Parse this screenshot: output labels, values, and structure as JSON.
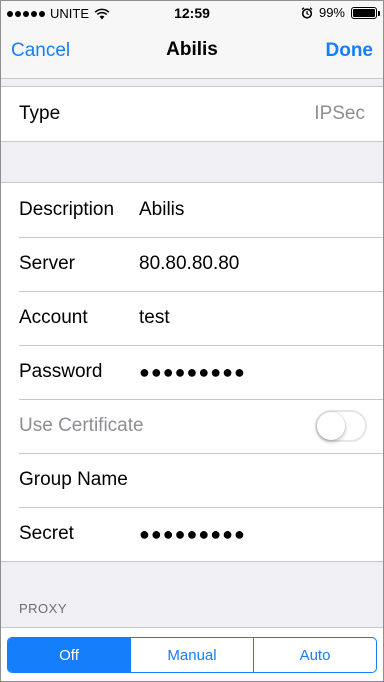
{
  "status_bar": {
    "carrier": "UNITE",
    "time": "12:59",
    "battery": "99%",
    "battery_level": 0.99
  },
  "nav": {
    "cancel_label": "Cancel",
    "title": "Abilis",
    "done_label": "Done"
  },
  "type_row": {
    "label": "Type",
    "value": "IPSec"
  },
  "fields": {
    "description": {
      "label": "Description",
      "value": "Abilis"
    },
    "server": {
      "label": "Server",
      "value": "80.80.80.80"
    },
    "account": {
      "label": "Account",
      "value": "test"
    },
    "password": {
      "label": "Password",
      "value": "●●●●●●●●●"
    },
    "use_certificate": {
      "label": "Use Certificate",
      "on": false
    },
    "group_name": {
      "label": "Group Name",
      "value": ""
    },
    "secret": {
      "label": "Secret",
      "value": "●●●●●●●●●"
    }
  },
  "proxy": {
    "header": "PROXY",
    "options": [
      "Off",
      "Manual",
      "Auto"
    ],
    "selected": "Off"
  },
  "colors": {
    "accent": "#147efb",
    "secondary_text": "#8e8e93",
    "background": "#efeff4"
  }
}
